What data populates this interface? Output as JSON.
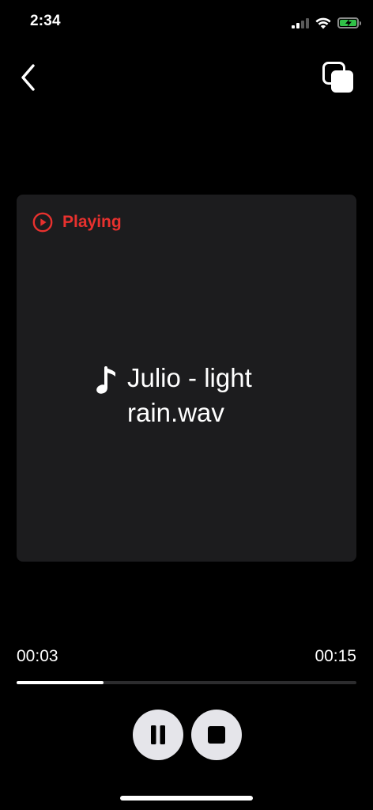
{
  "status_bar": {
    "time": "2:34"
  },
  "nav": {
    "back_icon": "chevron-left-icon",
    "copy_icon": "copy-icon"
  },
  "player": {
    "status": "Playing",
    "status_color": "#e8312e",
    "track_name": "Julio - light rain.wav",
    "music_icon": "music-note-icon"
  },
  "progress": {
    "current": "00:03",
    "total": "00:15",
    "fraction": 0.255
  },
  "controls": {
    "pause_icon": "pause-icon",
    "stop_icon": "stop-icon"
  },
  "colors": {
    "background": "#000000",
    "card": "#1c1c1e",
    "accent": "#e8312e",
    "battery": "#31c048"
  }
}
